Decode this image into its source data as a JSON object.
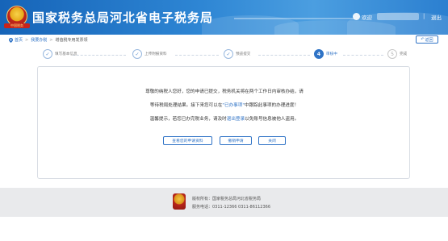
{
  "header": {
    "title": "国家税务总局河北省电子税务局",
    "emblem_text": "中国税务",
    "welcome": "欢迎",
    "divider": "|",
    "logout": "退出"
  },
  "breadcrumb": {
    "home": "首页",
    "level2": "我要办税",
    "current": "增值税专用发票领",
    "sep": ">"
  },
  "back_button": "返回",
  "steps": [
    {
      "num": "✓",
      "label": "填写基本信息",
      "state": "done"
    },
    {
      "num": "✓",
      "label": "上传附报资料",
      "state": "done"
    },
    {
      "num": "✓",
      "label": "预览提交",
      "state": "done"
    },
    {
      "num": "4",
      "label": "审核中",
      "state": "active"
    },
    {
      "num": "5",
      "label": "完成",
      "state": "pending"
    }
  ],
  "message": {
    "line1": "尊敬的纳税人您好，您的申请已提交，税务机关将在两个工作日内审核办结，请",
    "line2_pre": "等待税局处理结果。接下来您可以在",
    "line2_link": "\"已办事项\"",
    "line2_post": "中跟踪此事项的办理进度！",
    "line3_pre": "温馨提示，若您已办完税业务，请及时",
    "line3_link": "退出登录",
    "line3_post": "以免账号信息被他人盗用。"
  },
  "buttons": {
    "view": "查看您的申请资料",
    "revoke": "撤销申请",
    "close": "关闭"
  },
  "footer": {
    "copyright": "版权所有：国家税务总局河北省税务局",
    "hotline": "服务电话：0311-12366 0311-86112366"
  },
  "colors": {
    "primary": "#2f73c6",
    "header_bg": "#1664b8",
    "footer_bg": "#e9eaec"
  }
}
